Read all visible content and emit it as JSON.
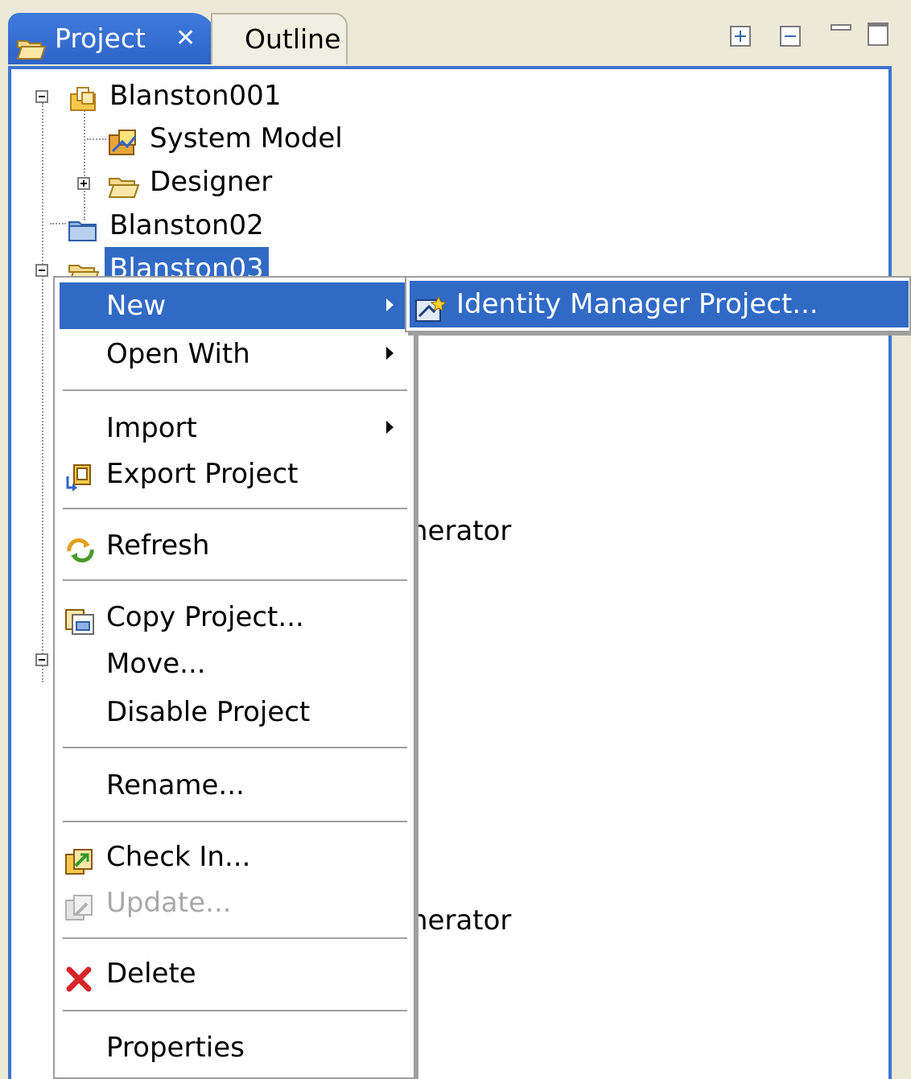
{
  "tabs": [
    {
      "label": "Project",
      "active": true,
      "close_glyph": "✕"
    },
    {
      "label": "Outline",
      "active": false
    }
  ],
  "tree": {
    "items": [
      {
        "label": "Blanston001",
        "icon": "project-icon",
        "expanded": true
      },
      {
        "label": "System Model",
        "icon": "system-model-icon"
      },
      {
        "label": "Designer",
        "icon": "folder-icon",
        "expanded": false
      },
      {
        "label": "Blanston02",
        "icon": "closed-project-icon"
      },
      {
        "label": "Blanston03",
        "icon": "folder-icon",
        "selected": true,
        "expanded": true
      }
    ],
    "partial_labels": [
      "nerator",
      "nerator"
    ]
  },
  "context_menu": {
    "items": [
      {
        "label": "New",
        "has_submenu": true,
        "active": true
      },
      {
        "label": "Open With",
        "has_submenu": true
      },
      {
        "label": "Import",
        "has_submenu": true
      },
      {
        "label": "Export Project",
        "icon": "export-icon"
      },
      {
        "label": "Refresh",
        "icon": "refresh-icon"
      },
      {
        "label": "Copy Project...",
        "icon": "copy-icon"
      },
      {
        "label": "Move..."
      },
      {
        "label": "Disable Project"
      },
      {
        "label": "Rename..."
      },
      {
        "label": "Check In...",
        "icon": "check-in-icon"
      },
      {
        "label": "Update...",
        "icon": "update-icon",
        "disabled": true
      },
      {
        "label": "Delete",
        "icon": "delete-icon"
      },
      {
        "label": "Properties"
      }
    ]
  },
  "submenu": {
    "items": [
      {
        "label": "Identity Manager Project...",
        "icon": "identity-manager-project-icon"
      }
    ]
  },
  "colors": {
    "selection": "#316ac5",
    "panel_border": "#3e74d0",
    "chrome": "#ece9d8"
  }
}
